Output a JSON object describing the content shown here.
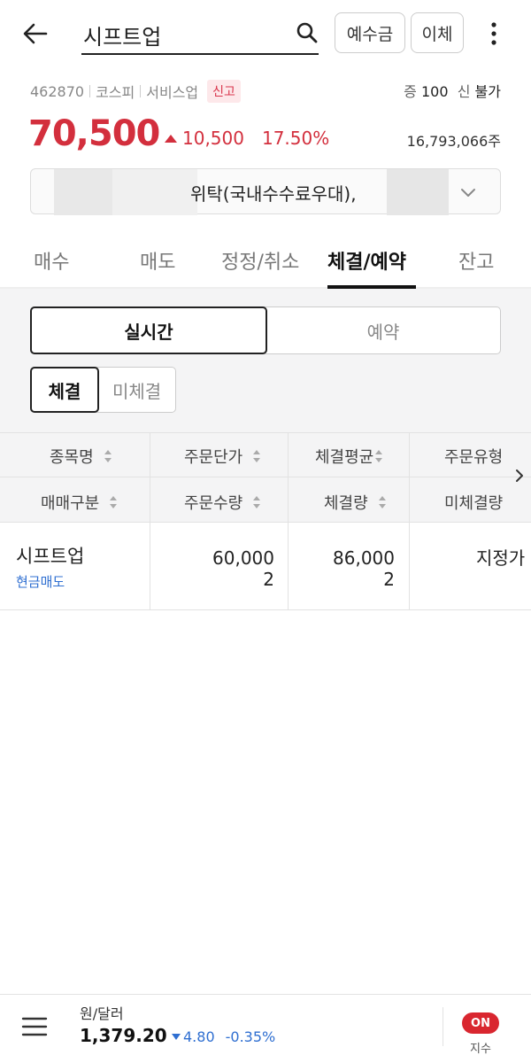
{
  "header": {
    "search_text": "시프트업",
    "deposit_label": "예수금",
    "transfer_label": "이체"
  },
  "stock": {
    "code": "462870",
    "market": "코스피",
    "sector": "서비스업",
    "badge": "신고",
    "margin_label": "증",
    "margin_value": "100",
    "credit_label": "신",
    "credit_value": "불가",
    "price": "70,500",
    "change": "10,500",
    "change_pct": "17.50%",
    "volume": "16,793,066주",
    "up_color": "#d32f3d"
  },
  "account": {
    "label": "위탁(국내수수료우대),"
  },
  "tabs": [
    "매수",
    "매도",
    "정정/취소",
    "체결/예약",
    "잔고"
  ],
  "active_tab": "체결/예약",
  "segments": [
    "실시간",
    "예약"
  ],
  "chips": [
    "체결",
    "미체결"
  ],
  "table": {
    "header_row1": [
      "종목명",
      "주문단가",
      "체결평균",
      "주문유형"
    ],
    "header_row2": [
      "매매구분",
      "주문수량",
      "체결량",
      "미체결량"
    ],
    "rows": [
      {
        "name": "시프트업",
        "side": "현금매도",
        "order_price": "60,000",
        "order_qty": "2",
        "avg_price": "86,000",
        "filled_qty": "2",
        "order_type": "지정가"
      }
    ]
  },
  "bottom": {
    "fx_name": "원/달러",
    "fx_value": "1,379.20",
    "fx_change": "4.80",
    "fx_pct": "-0.35%",
    "toggle_label": "ON",
    "toggle_caption": "지수",
    "down_color": "#2f6fd1"
  }
}
